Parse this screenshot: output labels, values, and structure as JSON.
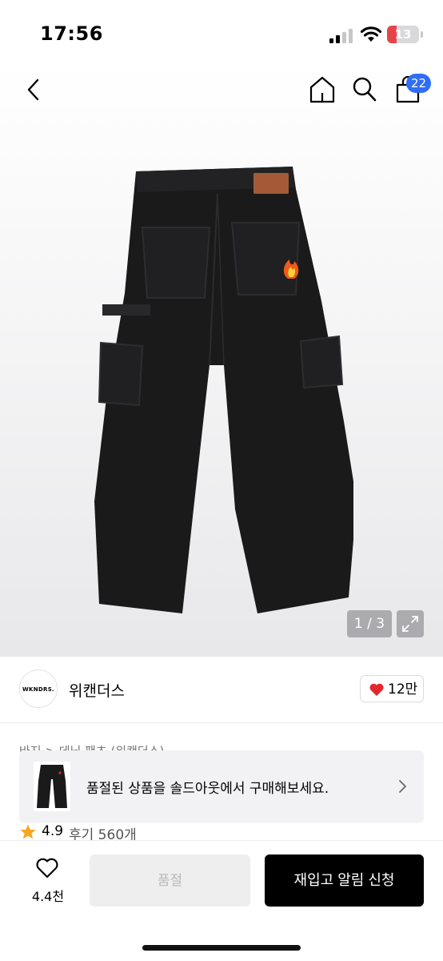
{
  "status_bar": {
    "time": "17:56",
    "battery": "13"
  },
  "header": {
    "cart_count": "22"
  },
  "gallery": {
    "pager": "1 / 3"
  },
  "brand": {
    "logo_text": "WKNDRS.",
    "name": "위캔더스",
    "likes": "12만"
  },
  "breadcrumb": "바지 > 데님 팬츠 (위캔더스)",
  "toast": {
    "message": "품절된 상품을 솔드아웃에서 구매해보세요."
  },
  "rating": {
    "score": "4.9",
    "review_label": "후기 560개"
  },
  "bottom_bar": {
    "wish_count": "4.4천",
    "soldout_label": "품절",
    "restock_label": "재입고 알림 신청"
  },
  "colors": {
    "accent_blue": "#2f6df6",
    "heart_red": "#e5262f",
    "star_orange": "#f5a623",
    "battery_red": "#e5454a"
  },
  "icons": [
    "back-icon",
    "home-icon",
    "search-icon",
    "cart-icon",
    "expand-icon",
    "heart-icon",
    "chevron-right-icon",
    "star-icon",
    "heart-outline-icon"
  ]
}
